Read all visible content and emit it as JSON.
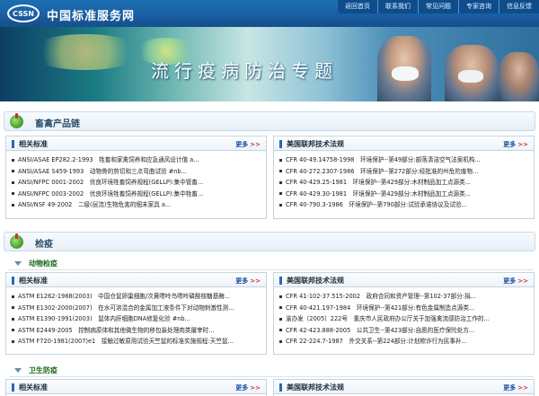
{
  "header": {
    "logo_text": "CSSN",
    "site_title": "中国标准服务网",
    "nav": [
      "返回首页",
      "联系我们",
      "常见问题",
      "专家咨询",
      "信息反馈"
    ]
  },
  "banner": {
    "title": "流行疫病防治专题"
  },
  "sections": [
    {
      "title": "畜禽产品链",
      "panels": [
        {
          "title": "相关标准",
          "more": "更多",
          "rows": [
            "ANSI/ASAE EP282.2-1993　牲畜和家禽饲养和应急通风设计值 a...",
            "ANSI/ASAE S459-1993　动物骨的剪切和三点弯曲试验 #nb...",
            "ANSI/NFPC 0001-2002　优良环境牲畜饲养规程(GELLP):集中管畜...",
            "ANSI/NFPC 0003-2002　优良环境牲畜饲养规程(GELLP):集中牲畜...",
            "ANSI/NSF 49-2002　二级(层流)生物危害的细末家具 a..."
          ]
        },
        {
          "title": "美国联邦技术法规",
          "more": "更多",
          "rows": [
            "CFR 40-49.14758-1998　环境保护--第49部分:部落清洁空气法案机构...",
            "CFR 40-272.2307-1986　环境保护--第272部分:经批准的州危险废物...",
            "CFR 40-429.25-1981　环境保护--第429部分:木材制品加工点源类...",
            "CFR 40-429.30-1981　环境保护--第429部分:木材制品加工点源类...",
            "CFR 40-790.3-1986　环境保护--第790部分:试验承诺协议及试验..."
          ]
        }
      ]
    },
    {
      "title": "检疫",
      "subsections": [
        {
          "title": "动物检疫",
          "panels": [
            {
              "title": "相关标准",
              "more": "更多",
              "rows": [
                "ASTM E1262-1988(2003)　中国仓鼠卵巢细胞/次黄嘌呤鸟嘌呤磷酸核糖基酶...",
                "ASTM E1302-2000(2007)　在水可溶混合的金属加工液条件下对动物刺激性测...",
                "ASTM E1390-1991(2003)　鼠体内肝细胞DNA修复化验 #nb...",
                "ASTM E2449-2005　控制病原体和其他微生物的移包装处理肉类屠宰时...",
                "ASTM F720-1981(2007)e1　接触过敏原用试验天竺鼠的标准实施规程:天竺鼠..."
              ]
            },
            {
              "title": "美国联邦技术法规",
              "more": "更多",
              "rows": [
                "CFR 41-102-37.515-2002　政府合同和资产管理--第102-37部分:捐...",
                "CFR 40-421.197-1984　环境保护--第421部分:有色金属制造点源类...",
                "渝办发〔2005〕222号　重庆市人民政府办公厅关于加强禽流感防治工作的...",
                "CFR 42-423.888-2005　公共卫生--第423部分:自愿的医疗保险处方...",
                "CFR 22-224.7-1987　外交关系--第224部分:计划欺诈行为民事补..."
              ]
            }
          ]
        },
        {
          "title": "卫生防疫",
          "panels": [
            {
              "title": "相关标准",
              "more": "更多"
            },
            {
              "title": "美国联邦技术法规",
              "more": "更多"
            }
          ]
        }
      ]
    }
  ]
}
